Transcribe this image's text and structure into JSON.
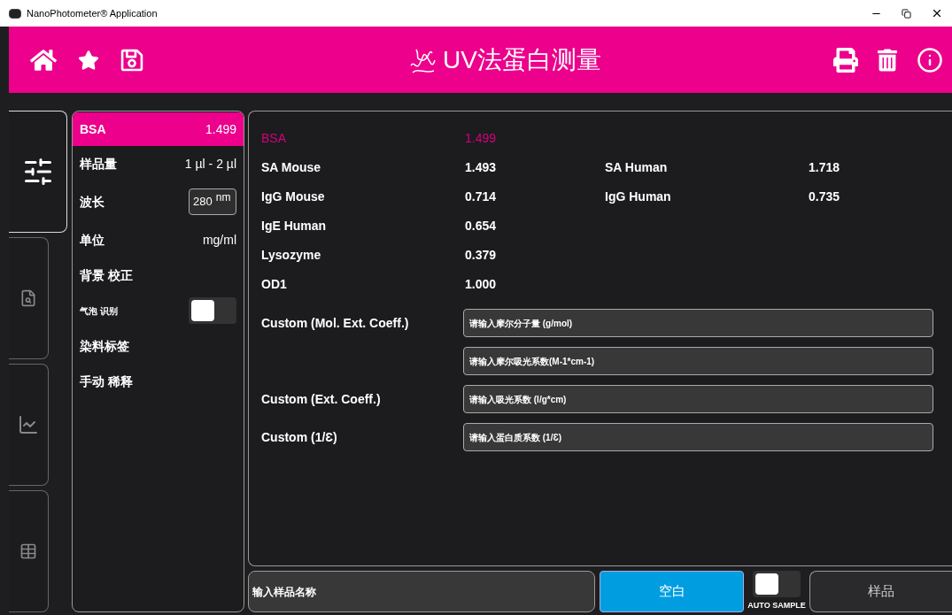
{
  "window": {
    "title": "NanoPhotometer® Application"
  },
  "header": {
    "title": "UV法蛋白测量"
  },
  "nav_tabs": [
    {
      "kind": "settings",
      "selected": true
    },
    {
      "kind": "report",
      "selected": false
    },
    {
      "kind": "chart",
      "selected": false
    },
    {
      "kind": "table",
      "selected": false
    }
  ],
  "settings": [
    {
      "kind": "value",
      "label": "BSA",
      "value": "1.499",
      "selected": true
    },
    {
      "kind": "value",
      "label": "样品量",
      "value": "1 µl - 2 µl",
      "selected": false
    },
    {
      "kind": "input",
      "label": "波长",
      "value": "280",
      "unit": "nm",
      "selected": false
    },
    {
      "kind": "value",
      "label": "单位",
      "value": "mg/ml",
      "selected": false
    },
    {
      "kind": "plain",
      "label": "背景 校正",
      "selected": false
    },
    {
      "kind": "toggle",
      "label": "气泡 识别",
      "on": false,
      "selected": false
    },
    {
      "kind": "plain",
      "label": "染料标签",
      "selected": false
    },
    {
      "kind": "plain",
      "label": "手动 稀释",
      "selected": false
    }
  ],
  "protein_rows": [
    [
      {
        "name": "BSA",
        "value": "1.499",
        "selected": true
      }
    ],
    [
      {
        "name": "SA Mouse",
        "value": "1.493",
        "selected": false
      },
      {
        "name": "SA Human",
        "value": "1.718",
        "selected": false
      }
    ],
    [
      {
        "name": "IgG Mouse",
        "value": "0.714",
        "selected": false
      },
      {
        "name": "IgG Human",
        "value": "0.735",
        "selected": false
      }
    ],
    [
      {
        "name": "IgE Human",
        "value": "0.654",
        "selected": false
      }
    ],
    [
      {
        "name": "Lysozyme",
        "value": "0.379",
        "selected": false
      }
    ],
    [
      {
        "name": "OD1",
        "value": "1.000",
        "selected": false
      }
    ]
  ],
  "custom_fields": [
    {
      "label": "Custom (Mol. Ext. Coeff.)",
      "placeholder": "请输入摩尔分子量 (g/mol)"
    },
    {
      "placeholder": "请输入摩尔吸光系数(M-1*cm-1)"
    },
    {
      "label": "Custom (Ext. Coeff.)",
      "placeholder": "请输入吸光系数 (l/g*cm)"
    },
    {
      "label": "Custom (1/Ɛ)",
      "placeholder": "请输入蛋白质系数 (1/Ɛ)"
    }
  ],
  "footer": {
    "sample_name": {
      "placeholder": "输入样品名称"
    },
    "blank_button": "空白",
    "auto_sample": {
      "label": "AUTO SAMPLE",
      "on": false
    },
    "sample_button": "样品"
  }
}
